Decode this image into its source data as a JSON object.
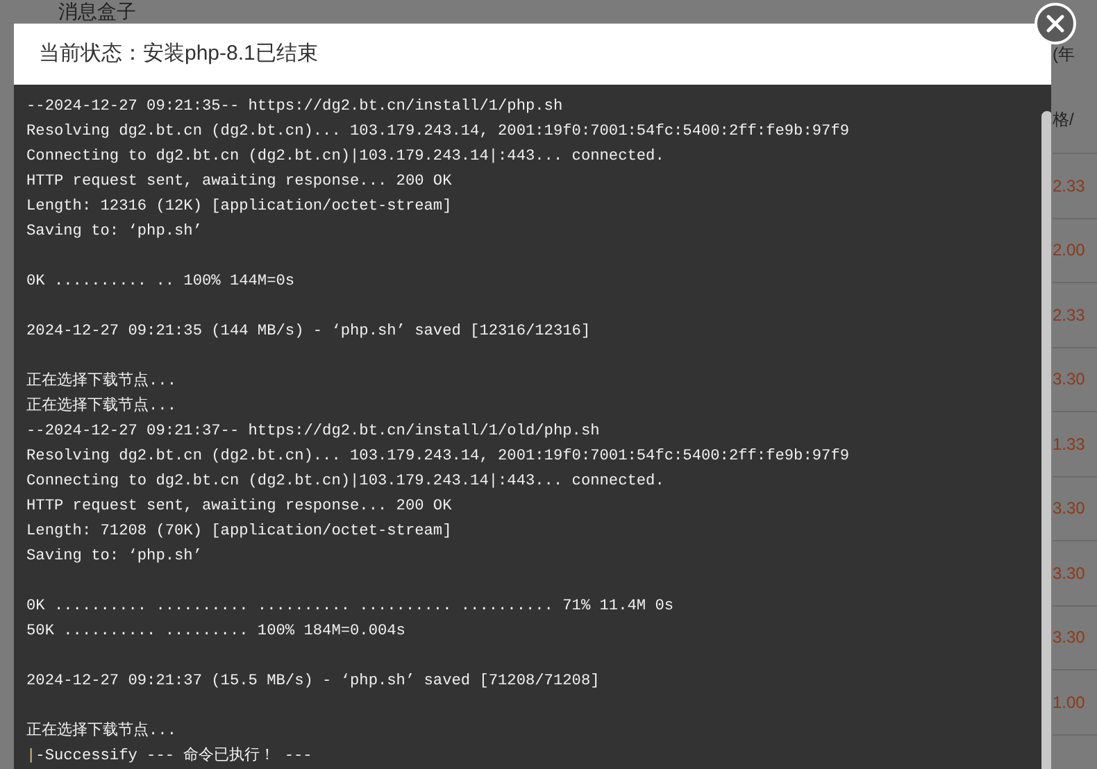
{
  "background": {
    "header_title": "消息盒子",
    "column_heading": "(年",
    "price_heading": "格/",
    "prices": [
      "2.33",
      "2.00",
      "2.33",
      "3.30",
      "1.33",
      "3.30",
      "3.30",
      "3.30",
      "1.00"
    ]
  },
  "dialog": {
    "title": "当前状态：安装php-8.1已结束",
    "log": [
      {
        "kind": "text",
        "text": "--2024-12-27 09:21:35-- https://dg2.bt.cn/install/1/php.sh"
      },
      {
        "kind": "text",
        "text": "Resolving dg2.bt.cn (dg2.bt.cn)... 103.179.243.14, 2001:19f0:7001:54fc:5400:2ff:fe9b:97f9"
      },
      {
        "kind": "text",
        "text": "Connecting to dg2.bt.cn (dg2.bt.cn)|103.179.243.14|:443... connected."
      },
      {
        "kind": "text",
        "text": "HTTP request sent, awaiting response... 200 OK"
      },
      {
        "kind": "text",
        "text": "Length: 12316 (12K) [application/octet-stream]"
      },
      {
        "kind": "text",
        "text": "Saving to: ‘php.sh’"
      },
      {
        "kind": "blank"
      },
      {
        "kind": "text",
        "text": "0K .......... .. 100% 144M=0s"
      },
      {
        "kind": "blank"
      },
      {
        "kind": "text",
        "text": "2024-12-27 09:21:35 (144 MB/s) - ‘php.sh’ saved [12316/12316]"
      },
      {
        "kind": "blank"
      },
      {
        "kind": "text",
        "text": "正在选择下载节点..."
      },
      {
        "kind": "text",
        "text": "正在选择下载节点..."
      },
      {
        "kind": "text",
        "text": "--2024-12-27 09:21:37-- https://dg2.bt.cn/install/1/old/php.sh"
      },
      {
        "kind": "text",
        "text": "Resolving dg2.bt.cn (dg2.bt.cn)... 103.179.243.14, 2001:19f0:7001:54fc:5400:2ff:fe9b:97f9"
      },
      {
        "kind": "text",
        "text": "Connecting to dg2.bt.cn (dg2.bt.cn)|103.179.243.14|:443... connected."
      },
      {
        "kind": "text",
        "text": "HTTP request sent, awaiting response... 200 OK"
      },
      {
        "kind": "text",
        "text": "Length: 71208 (70K) [application/octet-stream]"
      },
      {
        "kind": "text",
        "text": "Saving to: ‘php.sh’"
      },
      {
        "kind": "blank"
      },
      {
        "kind": "text",
        "text": "0K .......... .......... .......... .......... .......... 71% 11.4M 0s"
      },
      {
        "kind": "text",
        "text": "50K .......... ......... 100% 184M=0.004s"
      },
      {
        "kind": "blank"
      },
      {
        "kind": "text",
        "text": "2024-12-27 09:21:37 (15.5 MB/s) - ‘php.sh’ saved [71208/71208]"
      },
      {
        "kind": "blank"
      },
      {
        "kind": "text",
        "text": "正在选择下载节点..."
      },
      {
        "kind": "result",
        "marker": "|",
        "text": "-Successify --- 命令已执行！ ---"
      }
    ]
  }
}
